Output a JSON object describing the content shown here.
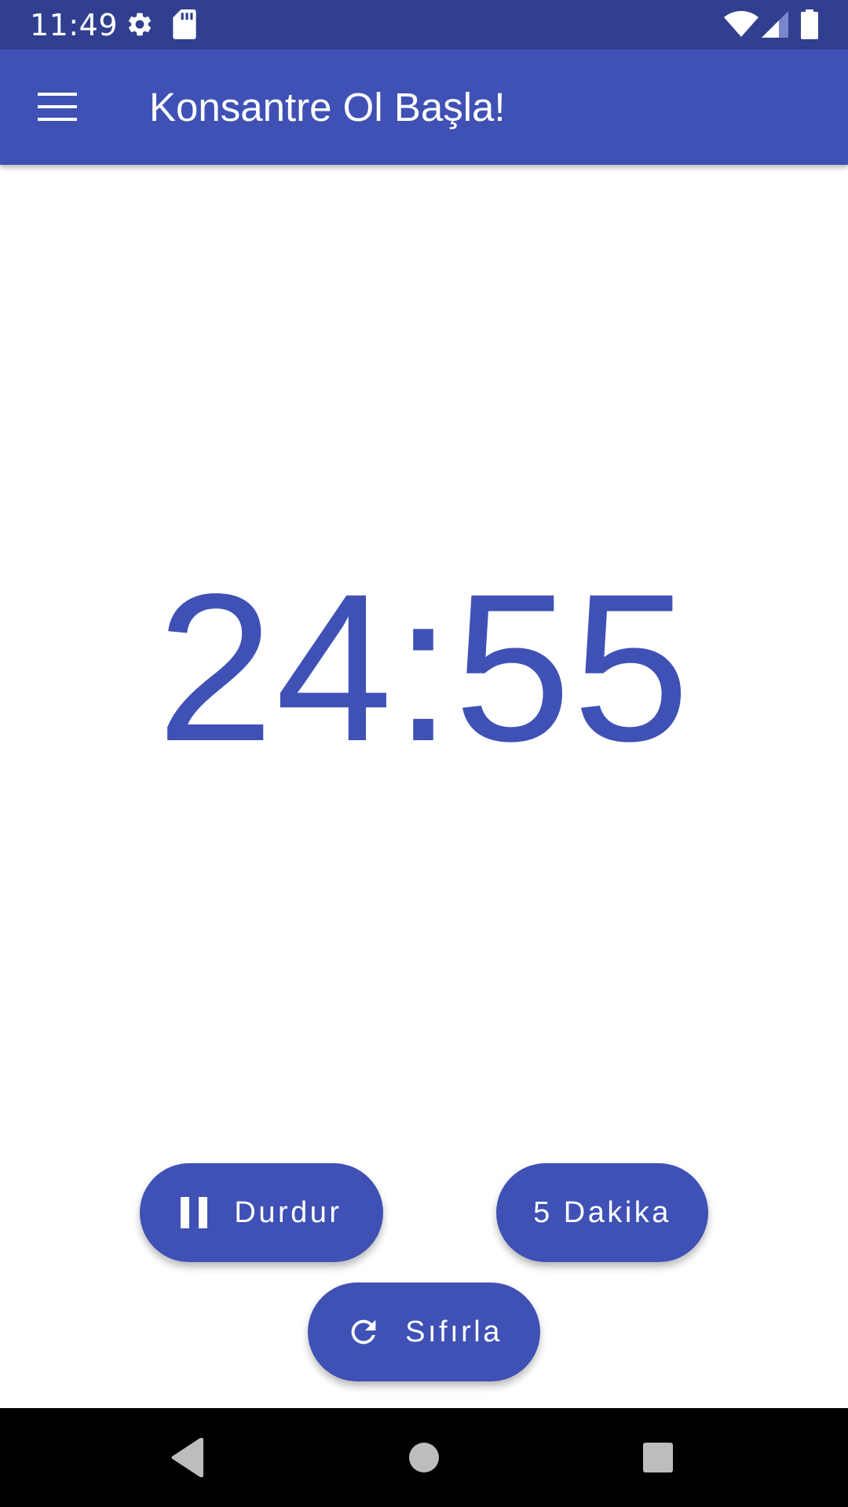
{
  "status_bar": {
    "time": "11:49",
    "icons": [
      "settings-gear-icon",
      "sd-card-icon",
      "wifi-icon",
      "cell-signal-icon",
      "battery-icon"
    ]
  },
  "app_bar": {
    "title": "Konsantre Ol Başla!",
    "menu_icon": "hamburger-menu-icon"
  },
  "timer": {
    "display": "24:55"
  },
  "buttons": {
    "pause_label": "Durdur",
    "pause_icon": "pause-icon",
    "five_min_label": "5 Dakika",
    "reset_label": "Sıfırla",
    "reset_icon": "refresh-icon"
  },
  "nav_bar": {
    "icons": [
      "back-triangle-icon",
      "home-circle-icon",
      "recents-square-icon"
    ]
  },
  "colors": {
    "status_bar": "#303F8F",
    "primary": "#3F51B5",
    "on_primary": "#FFFFFF",
    "nav_bar": "#000000",
    "nav_icons": "#BDBDBD"
  }
}
